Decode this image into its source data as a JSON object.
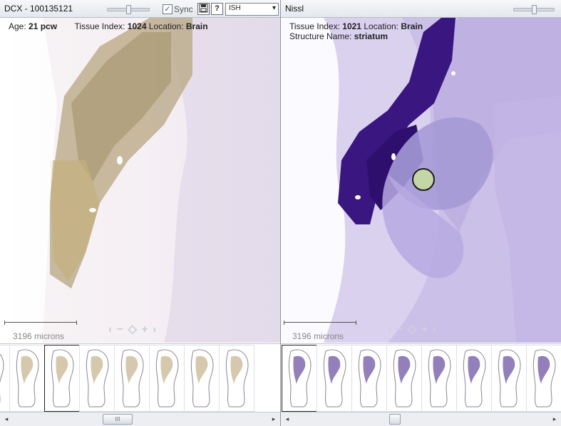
{
  "left": {
    "title": "DCX - 100135121",
    "sync_label": "Sync",
    "sync_checked": "✓",
    "save_icon": "save-icon",
    "help_icon": "help-icon",
    "help_glyph": "?",
    "select_value": "ISH",
    "age_label": "Age:",
    "age_value": "21 pcw",
    "tissue_label": "Tissue Index:",
    "tissue_value": "1024",
    "location_label": "Location:",
    "location_value": "Brain",
    "scale_label": "3196 microns",
    "thumb_count": 8,
    "selected_thumb": 2,
    "stain_color": "#b39a6a",
    "scroll_grip": "III"
  },
  "right": {
    "title": "Nissl",
    "tissue_label": "Tissue Index:",
    "tissue_value": "1021",
    "location_label": "Location:",
    "location_value": "Brain",
    "structure_label": "Structure Name:",
    "structure_value": "striatum",
    "scale_label": "3196 microns",
    "thumb_count": 9,
    "selected_thumb": 0,
    "stain_color": "#3a1680",
    "marker_color": "#c5d6a6"
  },
  "icons": {
    "scroll_left": "◂",
    "scroll_right": "▸",
    "select_arrow": "▾",
    "nav": "‹ − ◇ + ›"
  }
}
